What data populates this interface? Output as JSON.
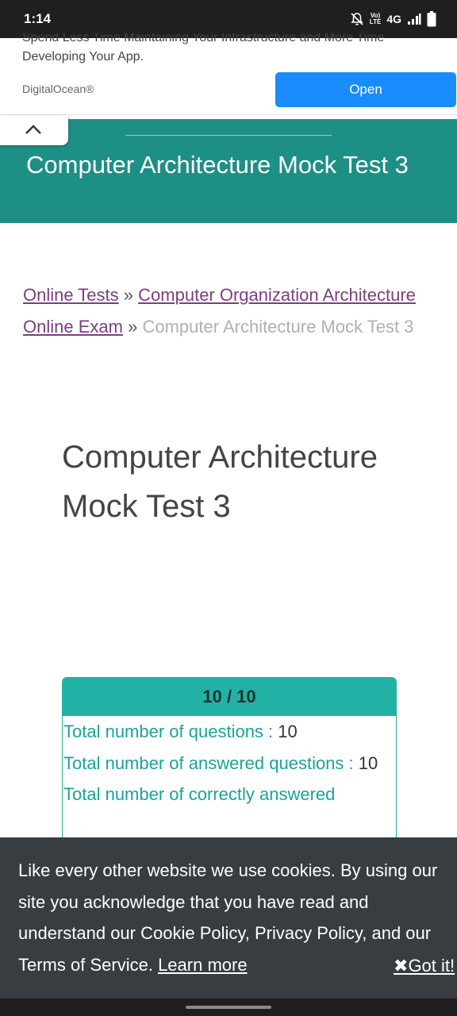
{
  "status_bar": {
    "time": "1:14",
    "network": "4G",
    "volte_top": "Vo)",
    "volte_bottom": "LTE",
    "icons": [
      "notifications-off-icon",
      "volte-icon",
      "signal-icon",
      "battery-icon"
    ]
  },
  "ad": {
    "line1": "Spend Less Time Maintaining Your Infrastructure and More Time",
    "line2": "Developing Your App.",
    "brand": "DigitalOcean®",
    "open_label": "Open",
    "button_color": "#1a8cff"
  },
  "header": {
    "title": "Computer Architecture Mock Test 3",
    "color": "#1e8f84"
  },
  "breadcrumb": {
    "link1": "Online Tests",
    "link2": "Computer Organization Architecture Online Exam",
    "current": "Computer Architecture Mock Test 3",
    "separator": "»"
  },
  "page_title": "Computer Architecture Mock Test 3",
  "results": {
    "score": "10 / 10",
    "rows": [
      {
        "label": "Total number of questions :",
        "value": "10"
      },
      {
        "label": "Total number of answered questions :",
        "value": "10"
      },
      {
        "label": "Total number of correctly answered",
        "value": ""
      }
    ]
  },
  "cookie_banner": {
    "text": "Like every other website we use cookies. By using our site you acknowledge that you have read and understand our Cookie Policy, Privacy Policy, and our Terms of Service.",
    "learn_more": "Learn more",
    "got_it": "Got it!",
    "got_it_icon": "✖"
  }
}
